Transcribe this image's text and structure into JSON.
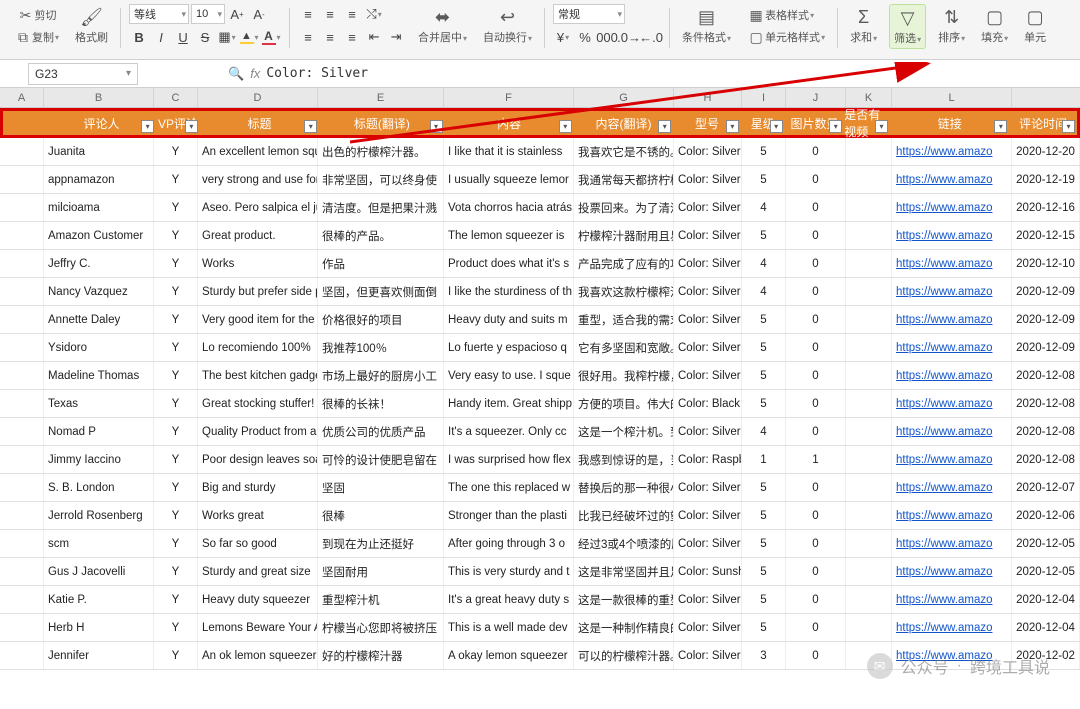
{
  "ribbon": {
    "cut": "剪切",
    "copy": "复制",
    "format_painter": "格式刷",
    "font_name": "等线",
    "font_size": "10",
    "merge_center": "合并居中",
    "auto_wrap": "自动换行",
    "number_format": "常规",
    "cond_format": "条件格式",
    "table_style": "表格样式",
    "cell_style": "单元格样式",
    "sum": "求和",
    "filter": "筛选",
    "sort": "排序",
    "fill": "填充",
    "cell": "单元"
  },
  "formula_bar": {
    "cell_ref": "G23",
    "formula": "Color: Silver"
  },
  "col_letters": [
    "A",
    "B",
    "C",
    "D",
    "E",
    "F",
    "G",
    "H",
    "I",
    "J",
    "K",
    "L"
  ],
  "filter_headers": [
    "评论人",
    "VP评论",
    "标题",
    "标题(翻译)",
    "内容",
    "内容(翻译)",
    "型号",
    "星级",
    "图片数量",
    "是否有视频",
    "链接",
    "评论时间"
  ],
  "link_text": "https://www.amazo",
  "rows": [
    {
      "b": "Juanita",
      "c": "Y",
      "d": "An excellent lemon squ",
      "e": "出色的柠檬榨汁器。",
      "f": "I like that it is stainless",
      "g": "我喜欢它是不锈的。我",
      "h": "Color: Silver",
      "i": "5",
      "j": "0",
      "m": "2020-12-20"
    },
    {
      "b": "appnamazon",
      "c": "Y",
      "d": "very strong and use for",
      "e": "非常坚固，可以终身使",
      "f": "I usually squeeze lemor",
      "g": "我通常每天都挤柠檬。",
      "h": "Color: Silver",
      "i": "5",
      "j": "0",
      "m": "2020-12-19"
    },
    {
      "b": "milcioama",
      "c": "Y",
      "d": "Aseo. Pero salpica el ju",
      "e": "清洁度。但是把果汁溅",
      "f": "Vota chorros hacia atrás",
      "g": "投票回来。为了清洁，",
      "h": "Color: Silver",
      "i": "4",
      "j": "0",
      "m": "2020-12-16"
    },
    {
      "b": "Amazon Customer",
      "c": "Y",
      "d": "Great product.",
      "e": "很棒的产品。",
      "f": "The lemon squeezer is",
      "g": "柠檬榨汁器耐用且易于",
      "h": "Color: Silver",
      "i": "5",
      "j": "0",
      "m": "2020-12-15"
    },
    {
      "b": "Jeffry C.",
      "c": "Y",
      "d": "Works",
      "e": "作品",
      "f": "Product does what it's s",
      "g": "产品完成了应有的功能",
      "h": "Color: Silver",
      "i": "4",
      "j": "0",
      "m": "2020-12-10"
    },
    {
      "b": "Nancy Vazquez",
      "c": "Y",
      "d": "Sturdy but prefer side p",
      "e": "坚固，但更喜欢侧面倒",
      "f": "I like the sturdiness of th",
      "g": "我喜欢这款柠檬榨汁器",
      "h": "Color: Silver",
      "i": "4",
      "j": "0",
      "m": "2020-12-09"
    },
    {
      "b": "Annette Daley",
      "c": "Y",
      "d": "Very good item for the",
      "e": "价格很好的项目",
      "f": "Heavy duty and suits m",
      "g": "重型，适合我的需求",
      "h": "Color: Silver",
      "i": "5",
      "j": "0",
      "m": "2020-12-09"
    },
    {
      "b": "Ysidoro",
      "c": "Y",
      "d": "Lo recomiendo 100%",
      "e": "我推荐100％",
      "f": "Lo fuerte y espacioso q",
      "g": "它有多坚固和宽敞。",
      "h": "Color: Silver",
      "i": "5",
      "j": "0",
      "m": "2020-12-09"
    },
    {
      "b": "Madeline  Thomas",
      "c": "Y",
      "d": "The best kitchen gadge",
      "e": "市场上最好的厨房小工",
      "f": "Very easy to use. I sque",
      "g": "很好用。我榨柠檬，效",
      "h": "Color: Silver",
      "i": "5",
      "j": "0",
      "m": "2020-12-08"
    },
    {
      "b": "Texas",
      "c": "Y",
      "d": "Great stocking stuffer!",
      "e": "很棒的长袜！",
      "f": "Handy item. Great shipp",
      "g": "方便的项目。伟大的托",
      "h": "Color: Black",
      "i": "5",
      "j": "0",
      "m": "2020-12-08"
    },
    {
      "b": "Nomad P",
      "c": "Y",
      "d": "Quality Product from a",
      "e": "优质公司的优质产品",
      "f": "It's a squeezer.   Only cc",
      "g": "这是一个榨汁机。到目",
      "h": "Color: Silver",
      "i": "4",
      "j": "0",
      "m": "2020-12-08"
    },
    {
      "b": "Jimmy Iaccino",
      "c": "Y",
      "d": "Poor design leaves soap",
      "e": "可怜的设计使肥皂留在",
      "f": "I was surprised how flex",
      "g": "我感到惊讶的是，当挤",
      "h": "Color: Raspbe",
      "i": "1",
      "j": "1",
      "m": "2020-12-08"
    },
    {
      "b": "S. B. London",
      "c": "Y",
      "d": "Big and sturdy",
      "e": "坚固",
      "f": "The one this replaced w",
      "g": "替换后的那一种很小，",
      "h": "Color: Silver",
      "i": "5",
      "j": "0",
      "m": "2020-12-07"
    },
    {
      "b": "Jerrold Rosenberg",
      "c": "Y",
      "d": "Works great",
      "e": "很棒",
      "f": "Stronger than the plasti",
      "g": "比我已经破坏过的塑料",
      "h": "Color: Silver",
      "i": "5",
      "j": "0",
      "m": "2020-12-06"
    },
    {
      "b": "scm",
      "c": "Y",
      "d": "So far so good",
      "e": "到现在为止还挺好",
      "f": "After going through 3 o",
      "g": "经过3或4个喷漆的压模",
      "h": "Color: Silver",
      "i": "5",
      "j": "0",
      "m": "2020-12-05"
    },
    {
      "b": "Gus J Jacovelli",
      "c": "Y",
      "d": "Sturdy and great size",
      "e": "坚固耐用",
      "f": "This is very sturdy and t",
      "g": "这是非常坚固并且足够",
      "h": "Color: Sunshir",
      "i": "5",
      "j": "0",
      "m": "2020-12-05"
    },
    {
      "b": "Katie P.",
      "c": "Y",
      "d": "Heavy duty squeezer",
      "e": "重型榨汁机",
      "f": "It's a great heavy duty s",
      "g": "这是一款很棒的重型榨",
      "h": "Color: Silver",
      "i": "5",
      "j": "0",
      "m": "2020-12-04"
    },
    {
      "b": "Herb H",
      "c": "Y",
      "d": "Lemons Beware Your Al",
      "e": "柠檬当心您即将被挤压",
      "f": "This is a well made dev",
      "g": "这是一种制作精良的柠",
      "h": "Color: Silver",
      "i": "5",
      "j": "0",
      "m": "2020-12-04"
    },
    {
      "b": "Jennifer",
      "c": "Y",
      "d": "An ok lemon squeezer",
      "e": "好的柠檬榨汁器",
      "f": "A okay lemon squeezer",
      "g": "可以的柠檬榨汁器。价",
      "h": "Color: Silver",
      "i": "3",
      "j": "0",
      "m": "2020-12-02"
    }
  ],
  "watermark": {
    "label1": "公众号",
    "label2": "跨境工具说"
  }
}
